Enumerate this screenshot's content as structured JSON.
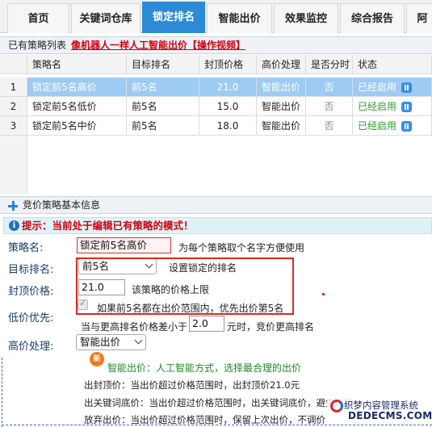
{
  "tabs": [
    {
      "label": "首页",
      "active": false
    },
    {
      "label": "关键词仓库",
      "active": false
    },
    {
      "label": "锁定排名",
      "active": true
    },
    {
      "label": "智能出价",
      "active": false
    },
    {
      "label": "效果监控",
      "active": false
    },
    {
      "label": "综合报告",
      "active": false
    },
    {
      "label": "阿",
      "active": false
    }
  ],
  "strategy_list": {
    "title": "已有策略列表",
    "video_link": "像机器人一样人工智能出价【操作视频】",
    "columns": [
      "策略名",
      "目标排名",
      "封顶价格",
      "高价处理",
      "是否分时",
      "状态"
    ],
    "rows": [
      {
        "index": "1",
        "name": "锁定前5名高价",
        "rank": "前5名",
        "cap": "21.0",
        "high": "智能出价",
        "timeshare": "否",
        "status": "已经启用",
        "selected": true
      },
      {
        "index": "2",
        "name": "锁定前5名低价",
        "rank": "前5名",
        "cap": "15.0",
        "high": "智能出价",
        "timeshare": "否",
        "status": "已经启用",
        "selected": false
      },
      {
        "index": "3",
        "name": "锁定前5名中价",
        "rank": "前5名",
        "cap": "18.0",
        "high": "智能出价",
        "timeshare": "否",
        "status": "已经启用",
        "selected": false
      }
    ]
  },
  "form": {
    "panel_title": "竞价策略基本信息",
    "hint": "提示：当前处于编辑已有策略的模式！",
    "name_label": "策略名:",
    "name_value": "锁定前5名高价",
    "name_help": "为每个策略取个名字方便使用",
    "rank_label": "目标排名:",
    "rank_value": "前5名",
    "rank_help": "设置锁定的排名",
    "cap_label": "封顶价格:",
    "cap_value": "21.0",
    "cap_help": "该策略的价格上限",
    "checkbox_text": "如果前5名都在出价范围内，优先出价第5名",
    "low_label": "低价优先:",
    "low_text_pre": "当与更高排名价格差小于",
    "low_value": "2.0",
    "low_text_post": "元时，竞价更高排名",
    "high_label": "高价处理:",
    "high_value": "智能出价",
    "new_badge": "新",
    "smart_line": "智能出价：人工智能方式，选择最合理的出价",
    "line1": "出封顶价：当出价超过价格范围时，出封顶价21.0元",
    "line2": "出关键词底价：当出价超过价格范围时，出关键词底价，避免烧钱",
    "line3": "放弃出价：当出价超过价格范围时，保留上次出价，不调价"
  },
  "watermark": {
    "line1": "织梦内容管理系统",
    "line2": "DEDECMS.COM"
  }
}
